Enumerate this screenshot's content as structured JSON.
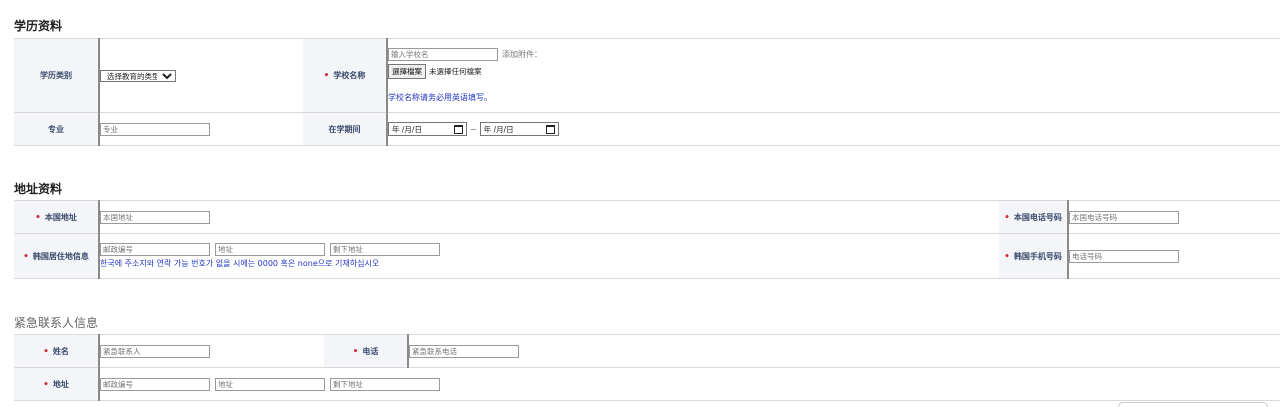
{
  "education": {
    "title": "学历资料",
    "degree_type_label": "学历类别",
    "degree_type_value": "选择教育的类型",
    "school_name_label": "学校名称",
    "school_name_placeholder": "输入学校名",
    "attach_label": "添加附件：",
    "file_button": "選擇檔案",
    "file_status": "未選擇任何檔案",
    "school_note": "学校名称请务必用英语填写。",
    "major_label": "专业",
    "major_placeholder": "专业",
    "period_label": "在学期间",
    "date_start": "年 /月/日",
    "date_end": "年 /月/日",
    "date_separator": "~"
  },
  "address": {
    "title": "地址资料",
    "home_address_label": "本国地址",
    "home_address_placeholder": "本国地址",
    "home_phone_label": "本国电话号码",
    "home_phone_placeholder": "本国电话号码",
    "korea_address_label": "韩国居住地信息",
    "zip_placeholder": "邮政编号",
    "addr_placeholder": "地址",
    "addr_rest_placeholder": "剩下地址",
    "korea_note": "한국에 주소지와 연락 가능 번호가 없을 시에는 0000 혹은 none으로 기재하십시오",
    "korea_mobile_label": "韩国手机号码",
    "korea_mobile_placeholder": "电话号码"
  },
  "emergency": {
    "title": "紧急联系人信息",
    "name_label": "姓名",
    "name_placeholder": "紧急联系人",
    "phone_label": "电话",
    "phone_placeholder": "紧急联系电话",
    "address_label": "地址",
    "zip_placeholder": "邮政编号",
    "addr_placeholder": "地址",
    "addr_rest_placeholder": "剩下地址"
  },
  "required_mark": "•",
  "colors": {
    "required": "#d0303a",
    "note": "#2236c8",
    "label_bg": "#f4f5f8",
    "label_text": "#3a4a6b"
  }
}
